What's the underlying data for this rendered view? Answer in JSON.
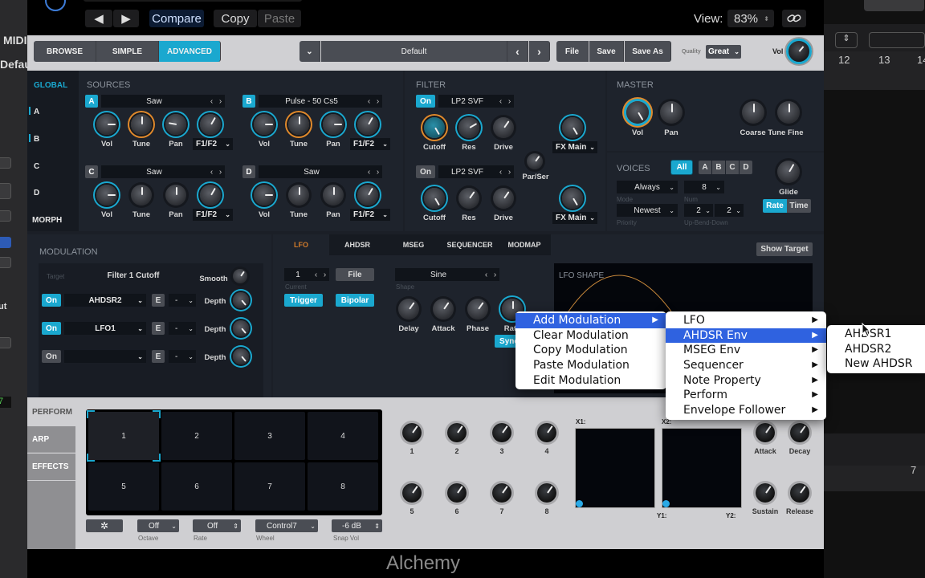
{
  "host": {
    "left_labels": [
      "MIDI",
      "Defau"
    ],
    "ruler_numbers": [
      "12",
      "13",
      "14"
    ],
    "ruler_lower": "7",
    "small_labels": [
      "ut",
      "7"
    ]
  },
  "plugin_header": {
    "prev_label": "◀",
    "next_label": "▶",
    "compare_label": "Compare",
    "copy_label": "Copy",
    "paste_label": "Paste",
    "view_label": "View:",
    "view_value": "83%",
    "link_icon": "🔗"
  },
  "top_bar": {
    "tabs": [
      {
        "label": "BROWSE",
        "active": false
      },
      {
        "label": "SIMPLE",
        "active": false
      },
      {
        "label": "ADVANCED",
        "active": true
      }
    ],
    "preset_name": "Default",
    "file_label": "File",
    "save_label": "Save",
    "save_as_label": "Save As",
    "quality_label": "Quality",
    "quality_value": "Great",
    "vol_label": "Vol"
  },
  "side_nav": {
    "global": "GLOBAL",
    "items": [
      "A",
      "B",
      "C",
      "D",
      "MORPH"
    ]
  },
  "sources": {
    "title": "SOURCES",
    "slots": [
      {
        "id": "A",
        "name": "Saw",
        "enabled": true,
        "knobs": [
          "Vol",
          "Tune",
          "Pan"
        ],
        "route": "F1/F2"
      },
      {
        "id": "B",
        "name": "Pulse - 50 Cs5",
        "enabled": true,
        "knobs": [
          "Vol",
          "Tune",
          "Pan"
        ],
        "route": "F1/F2"
      },
      {
        "id": "C",
        "name": "Saw",
        "enabled": false,
        "knobs": [
          "Vol",
          "Tune",
          "Pan"
        ],
        "route": "F1/F2"
      },
      {
        "id": "D",
        "name": "Saw",
        "enabled": false,
        "knobs": [
          "Vol",
          "Tune",
          "Pan"
        ],
        "route": "F1/F2"
      }
    ]
  },
  "filter": {
    "title": "FILTER",
    "filters": [
      {
        "on_label": "On",
        "enabled": true,
        "type": "LP2 SVF",
        "knobs": [
          "Cutoff",
          "Res",
          "Drive"
        ],
        "fx": "FX Main"
      },
      {
        "on_label": "On",
        "enabled": false,
        "type": "LP2 SVF",
        "knobs": [
          "Cutoff",
          "Res",
          "Drive"
        ],
        "fx": "FX Main"
      }
    ],
    "par_ser_label": "Par/Ser"
  },
  "master": {
    "title": "MASTER",
    "knobs": [
      "Vol",
      "Pan"
    ],
    "tune_label": "Coarse Tune Fine"
  },
  "voices": {
    "title": "VOICES",
    "all_label": "All",
    "letters": [
      "A",
      "B",
      "C",
      "D"
    ],
    "mode_value": "Always",
    "mode_label": "Mode",
    "num_value": "8",
    "num_label": "Num",
    "priority_value": "Newest",
    "priority_label": "Priority",
    "bend_up": "2",
    "bend_down": "2",
    "bend_label": "Up-Bend-Down",
    "glide_label": "Glide",
    "rate_label": "Rate",
    "time_label": "Time"
  },
  "modulation": {
    "title": "MODULATION",
    "target_label": "Target",
    "target_value": "Filter 1 Cutoff",
    "smooth_label": "Smooth",
    "rows": [
      {
        "on_label": "On",
        "enabled": true,
        "source": "AHDSR2",
        "e_label": "E",
        "via": "-",
        "depth_label": "Depth"
      },
      {
        "on_label": "On",
        "enabled": true,
        "source": "LFO1",
        "e_label": "E",
        "via": "-",
        "depth_label": "Depth"
      },
      {
        "on_label": "On",
        "enabled": false,
        "source": "",
        "e_label": "E",
        "via": "-",
        "depth_label": "Depth"
      }
    ]
  },
  "lfo_panel": {
    "tabs": [
      {
        "label": "LFO",
        "active": true
      },
      {
        "label": "AHDSR",
        "active": false
      },
      {
        "label": "MSEG",
        "active": false
      },
      {
        "label": "SEQUENCER",
        "active": false
      },
      {
        "label": "MODMAP",
        "active": false
      }
    ],
    "show_target_label": "Show Target",
    "current_value": "1",
    "current_label": "Current",
    "file_label": "File",
    "shape_value": "Sine",
    "shape_label": "Shape",
    "trigger_label": "Trigger",
    "bipolar_label": "Bipolar",
    "knobs": [
      "Delay",
      "Attack",
      "Phase",
      "Rate"
    ],
    "sync_label": "Sync",
    "shape_title": "LFO SHAPE"
  },
  "context_menu": {
    "main": [
      {
        "label": "Add Modulation",
        "highlighted": true,
        "submenu": true
      },
      {
        "label": "Clear Modulation",
        "highlighted": false,
        "submenu": false
      },
      {
        "label": "Copy Modulation",
        "highlighted": false,
        "submenu": false
      },
      {
        "label": "Paste Modulation",
        "highlighted": false,
        "submenu": false
      },
      {
        "label": "Edit Modulation",
        "highlighted": false,
        "submenu": false
      }
    ],
    "sub": [
      {
        "label": "LFO",
        "highlighted": false
      },
      {
        "label": "AHDSR Env",
        "highlighted": true
      },
      {
        "label": "MSEG Env",
        "highlighted": false
      },
      {
        "label": "Sequencer",
        "highlighted": false
      },
      {
        "label": "Note Property",
        "highlighted": false
      },
      {
        "label": "Perform",
        "highlighted": false
      },
      {
        "label": "Envelope Follower",
        "highlighted": false
      }
    ],
    "sub2": [
      {
        "label": "AHDSR1"
      },
      {
        "label": "AHDSR2"
      },
      {
        "label": "New AHDSR"
      }
    ],
    "arrow": "▶"
  },
  "perform": {
    "tabs": [
      {
        "label": "PERFORM",
        "active": true
      },
      {
        "label": "ARP",
        "active": false
      },
      {
        "label": "EFFECTS",
        "active": false
      }
    ],
    "pads": [
      "1",
      "2",
      "3",
      "4",
      "5",
      "6",
      "7",
      "8"
    ],
    "selected_pad": "1",
    "gear_icon": "✲",
    "octave_value": "Off",
    "octave_label": "Octave",
    "rate_value": "Off",
    "rate_label": "Rate",
    "wheel_value": "Control7",
    "wheel_label": "Wheel",
    "snapvol_value": "-6 dB",
    "snapvol_label": "Snap Vol",
    "macro_knobs": [
      "1",
      "2",
      "3",
      "4",
      "5",
      "6",
      "7",
      "8"
    ],
    "xy_labels": [
      "X1:",
      "Y1:",
      "X2:",
      "Y2:"
    ],
    "env_knobs": [
      "Attack",
      "Decay",
      "Sustain",
      "Release"
    ]
  },
  "footer": {
    "title": "Alchemy"
  },
  "colors": {
    "accent": "#1aa8cf",
    "orange": "#e0892b",
    "menu_highlight": "#2f62e0"
  }
}
